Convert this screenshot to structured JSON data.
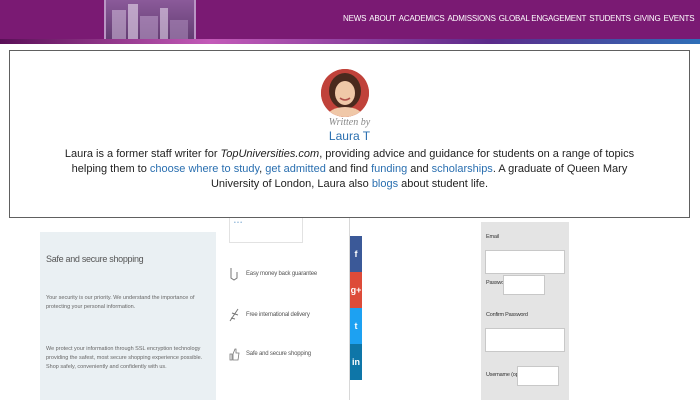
{
  "header": {
    "nav": [
      "NEWS",
      "ABOUT",
      "ACADEMICS",
      "ADMISSIONS",
      "GLOBAL ENGAGEMENT",
      "STUDENTS",
      "GIVING",
      "EVENTS"
    ],
    "brand_color": "#7a1a73"
  },
  "author": {
    "written_by": "Written by",
    "name": "Laura T",
    "bio": {
      "t1": "Laura is a former staff writer for ",
      "site": "TopUniversities.com",
      "t2": ", providing advice and guidance for students on a range of topics helping them to ",
      "link1": "choose where to study",
      "t3": ", ",
      "link2": "get admitted",
      "t4": " and find ",
      "link3": "funding",
      "t5": " and ",
      "link4": "scholarships",
      "t6": ". A graduate of Queen Mary University of London, Laura also ",
      "link5": "blogs",
      "t7": " about student life."
    },
    "link_color": "#2a6fb0"
  },
  "secure": {
    "title": "Safe and secure shopping",
    "p1": "Your security is our priority. We understand the importance of protecting your personal information.",
    "p2": "We protect your information through SSL encryption technology providing the safest, most secure shopping experience possible. Shop safely, conveniently and confidently with us."
  },
  "features": [
    {
      "label": "Easy money back guarantee",
      "icon": "handshake-icon"
    },
    {
      "label": "Free international delivery",
      "icon": "plane-icon"
    },
    {
      "label": "Safe and secure shopping",
      "icon": "thumbs-up-icon"
    }
  ],
  "social": [
    {
      "glyph": "f",
      "name": "facebook-share-icon",
      "color": "#3b5998"
    },
    {
      "glyph": "g+",
      "name": "google-plus-share-icon",
      "color": "#dd4b39"
    },
    {
      "glyph": "t",
      "name": "twitter-share-icon",
      "color": "#1da1f2"
    },
    {
      "glyph": "in",
      "name": "linkedin-share-icon",
      "color": "#0e76a8"
    }
  ],
  "form": {
    "email_label": "Email",
    "password_label": "Password",
    "confirm_label": "Confirm Password",
    "username_label": "Username (optional)"
  }
}
